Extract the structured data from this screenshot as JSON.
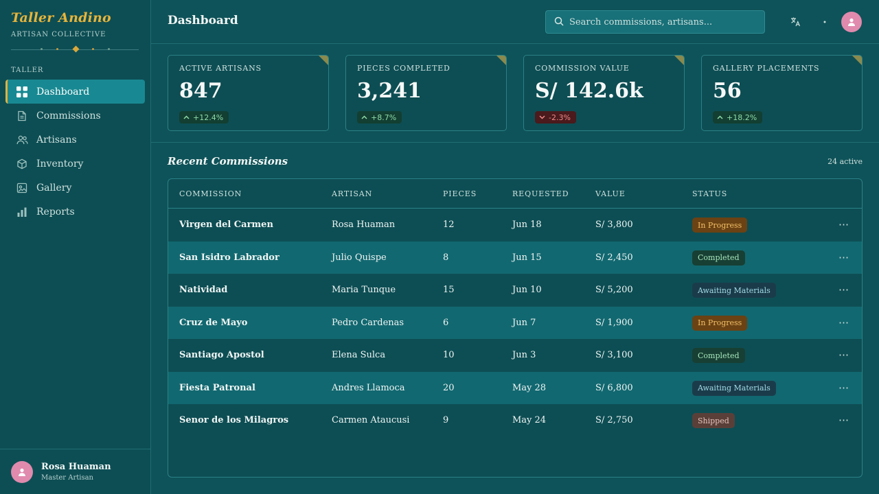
{
  "brand": {
    "title": "Taller Andino",
    "subtitle": "ARTISAN COLLECTIVE"
  },
  "sidebar": {
    "section_label": "TALLER",
    "items": [
      {
        "label": "Dashboard",
        "icon": "grid-icon",
        "active": true
      },
      {
        "label": "Commissions",
        "icon": "document-icon"
      },
      {
        "label": "Artisans",
        "icon": "users-icon"
      },
      {
        "label": "Inventory",
        "icon": "box-icon"
      },
      {
        "label": "Gallery",
        "icon": "image-icon"
      },
      {
        "label": "Reports",
        "icon": "bar-chart-icon"
      }
    ]
  },
  "user": {
    "name": "Rosa Huaman",
    "role": "Master Artisan"
  },
  "header": {
    "title": "Dashboard",
    "search_placeholder": "Search commissions, artisans..."
  },
  "stats": [
    {
      "label": "ACTIVE ARTISANS",
      "value": "847",
      "delta": "+12.4%",
      "direction": "up"
    },
    {
      "label": "PIECES COMPLETED",
      "value": "3,241",
      "delta": "+8.7%",
      "direction": "up"
    },
    {
      "label": "COMMISSION VALUE",
      "value": "S/ 142.6k",
      "delta": "-2.3%",
      "direction": "down"
    },
    {
      "label": "GALLERY PLACEMENTS",
      "value": "56",
      "delta": "+18.2%",
      "direction": "up"
    }
  ],
  "recent": {
    "title": "Recent Commissions",
    "count": "24 active",
    "columns": [
      "COMMISSION",
      "ARTISAN",
      "PIECES",
      "REQUESTED",
      "VALUE",
      "STATUS"
    ],
    "rows": [
      {
        "commission": "Virgen del Carmen",
        "artisan": "Rosa Huaman",
        "pieces": "12",
        "requested": "Jun 18",
        "value": "S/ 3,800",
        "status": "In Progress"
      },
      {
        "commission": "San Isidro Labrador",
        "artisan": "Julio Quispe",
        "pieces": "8",
        "requested": "Jun 15",
        "value": "S/ 2,450",
        "status": "Completed"
      },
      {
        "commission": "Natividad",
        "artisan": "Maria Tunque",
        "pieces": "15",
        "requested": "Jun 10",
        "value": "S/ 5,200",
        "status": "Awaiting Materials"
      },
      {
        "commission": "Cruz de Mayo",
        "artisan": "Pedro Cardenas",
        "pieces": "6",
        "requested": "Jun 7",
        "value": "S/ 1,900",
        "status": "In Progress"
      },
      {
        "commission": "Santiago Apostol",
        "artisan": "Elena Sulca",
        "pieces": "10",
        "requested": "Jun 3",
        "value": "S/ 3,100",
        "status": "Completed"
      },
      {
        "commission": "Fiesta Patronal",
        "artisan": "Andres Llamoca",
        "pieces": "20",
        "requested": "May 28",
        "value": "S/ 6,800",
        "status": "Awaiting Materials"
      },
      {
        "commission": "Senor de los Milagros",
        "artisan": "Carmen Ataucusi",
        "pieces": "9",
        "requested": "May 24",
        "value": "S/ 2,750",
        "status": "Shipped"
      }
    ]
  },
  "colors": {
    "accent": "#188992",
    "brand_gold": "#e8b43a",
    "background": "#0e5359",
    "avatar": "#e08aae"
  }
}
